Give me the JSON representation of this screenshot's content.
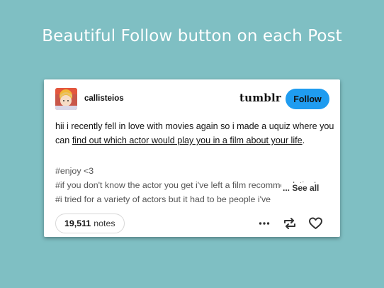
{
  "headline": "Beautiful Follow button on each Post",
  "post": {
    "username": "callisteios",
    "brand": "tumblr",
    "follow_label": "Follow",
    "body_text_prefix": "hii i recently fell in love with movies again so i made a uquiz where you can ",
    "body_link": "find out which actor would play you in a film about your life",
    "body_suffix": ".",
    "tags": [
      "#enjoy <3",
      "#if you don't know the actor you get i've left a film recommendation!",
      "#i tried for a variety of actors but it had to be people i've"
    ],
    "see_all": "... See all",
    "notes_count": "19,511",
    "notes_label": "notes",
    "icons": [
      "more-icon",
      "reblog-icon",
      "like-icon"
    ]
  }
}
